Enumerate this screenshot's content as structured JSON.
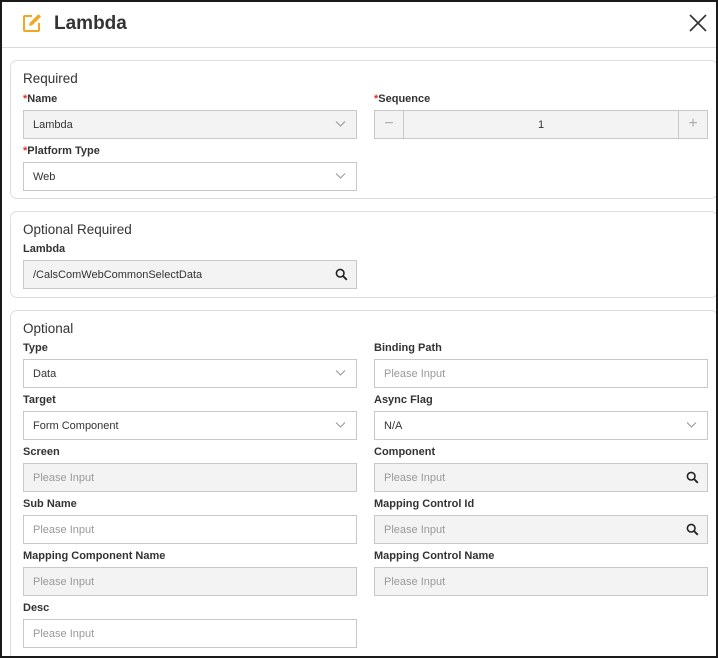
{
  "dialog": {
    "title": "Lambda"
  },
  "required": {
    "title": "Required",
    "name": {
      "label": "Name",
      "value": "Lambda"
    },
    "sequence": {
      "label": "Sequence",
      "value": "1",
      "minus": "−",
      "plus": "+"
    },
    "platform_type": {
      "label": "Platform Type",
      "value": "Web"
    }
  },
  "optional_required": {
    "title": "Optional Required",
    "lambda": {
      "label": "Lambda",
      "value": "/CalsComWebCommonSelectData"
    }
  },
  "optional": {
    "title": "Optional",
    "type": {
      "label": "Type",
      "value": "Data"
    },
    "binding_path": {
      "label": "Binding Path",
      "placeholder": "Please Input"
    },
    "target": {
      "label": "Target",
      "value": "Form Component"
    },
    "async_flag": {
      "label": "Async Flag",
      "value": "N/A"
    },
    "screen": {
      "label": "Screen",
      "placeholder": "Please Input"
    },
    "component": {
      "label": "Component",
      "placeholder": "Please Input"
    },
    "sub_name": {
      "label": "Sub Name",
      "placeholder": "Please Input"
    },
    "mapping_control_id": {
      "label": "Mapping Control Id",
      "placeholder": "Please Input"
    },
    "mapping_component_name": {
      "label": "Mapping Component Name",
      "placeholder": "Please Input"
    },
    "mapping_control_name": {
      "label": "Mapping Control Name",
      "placeholder": "Please Input"
    },
    "desc": {
      "label": "Desc",
      "placeholder": "Please Input"
    }
  },
  "colors": {
    "accent": "#f5a623",
    "required_mark": "#e0312a",
    "readonly_bg": "#f3f3f3",
    "border": "#c8c8c8"
  },
  "icons": {
    "title": "edit-icon",
    "close": "close-icon",
    "select": "chevron-down-icon",
    "lookup": "search-icon"
  }
}
